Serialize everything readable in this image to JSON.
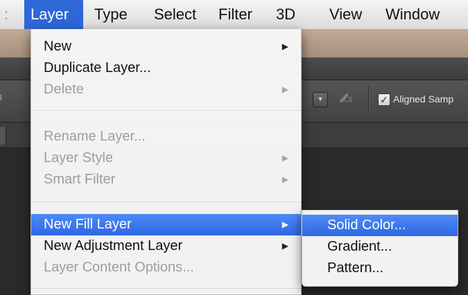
{
  "menubar": {
    "items": [
      {
        "label": "Layer",
        "active": true
      },
      {
        "label": "Type"
      },
      {
        "label": "Select"
      },
      {
        "label": "Filter"
      },
      {
        "label": "3D"
      },
      {
        "label": "View"
      },
      {
        "label": "Window"
      }
    ]
  },
  "options_bar": {
    "aligned_sample_label": "Aligned Samp",
    "aligned_checked": true
  },
  "layer_menu": {
    "items": [
      {
        "label": "New",
        "enabled": true,
        "submenu": true
      },
      {
        "label": "Duplicate Layer...",
        "enabled": true,
        "submenu": false
      },
      {
        "label": "Delete",
        "enabled": false,
        "submenu": true
      },
      {
        "label": "Rename Layer...",
        "enabled": false,
        "submenu": false
      },
      {
        "label": "Layer Style",
        "enabled": false,
        "submenu": true
      },
      {
        "label": "Smart Filter",
        "enabled": false,
        "submenu": true
      },
      {
        "label": "New Fill Layer",
        "enabled": true,
        "submenu": true,
        "highlighted": true
      },
      {
        "label": "New Adjustment Layer",
        "enabled": true,
        "submenu": true
      },
      {
        "label": "Layer Content Options...",
        "enabled": false,
        "submenu": false
      }
    ]
  },
  "fill_submenu": {
    "items": [
      {
        "label": "Solid Color...",
        "highlighted": true
      },
      {
        "label": "Gradient..."
      },
      {
        "label": "Pattern..."
      }
    ]
  },
  "icons": {
    "submenu_arrow": "triangle-right-icon",
    "dropdown": "dropdown-arrow-icon",
    "brush": "pressure-brush-icon",
    "check": "checkmark-icon"
  },
  "colors": {
    "highlight": "#2f67d9",
    "menu_bg": "#f6f6f6",
    "disabled_text": "#9d9d9d"
  }
}
